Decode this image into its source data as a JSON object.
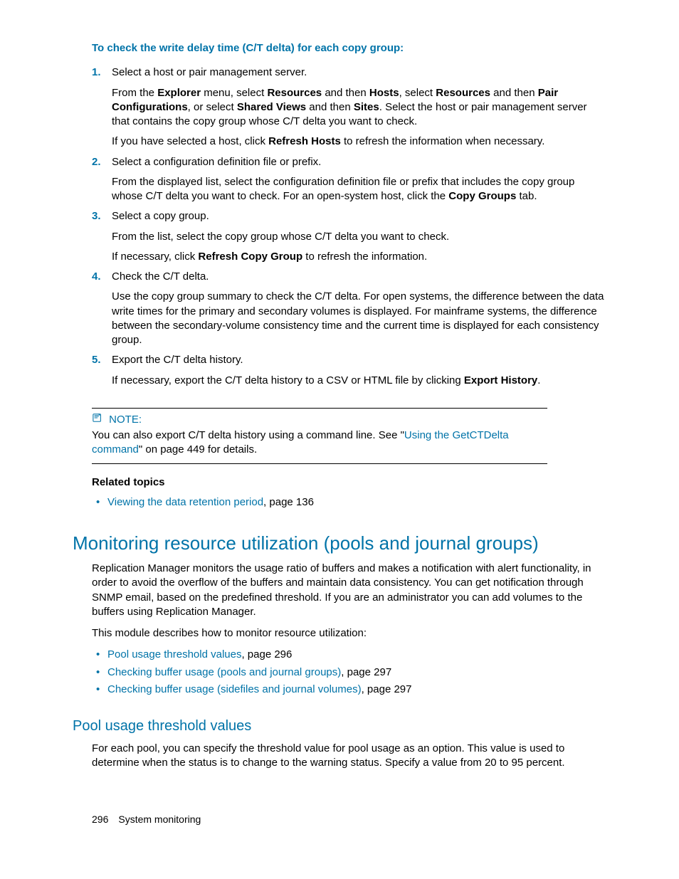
{
  "intro_heading": "To check the write delay time (C/T delta) for each copy group:",
  "steps": [
    {
      "num": "1.",
      "lead": "Select a host or pair management server.",
      "paras": [
        {
          "parts": [
            {
              "t": "From the "
            },
            {
              "b": "Explorer"
            },
            {
              "t": " menu, select "
            },
            {
              "b": "Resources"
            },
            {
              "t": " and then "
            },
            {
              "b": "Hosts"
            },
            {
              "t": ", select "
            },
            {
              "b": "Resources"
            },
            {
              "t": " and then "
            },
            {
              "b": "Pair Configurations"
            },
            {
              "t": ", or select "
            },
            {
              "b": "Shared Views"
            },
            {
              "t": " and then "
            },
            {
              "b": "Sites"
            },
            {
              "t": ". Select the host or pair management server that contains the copy group whose C/T delta you want to check."
            }
          ]
        },
        {
          "parts": [
            {
              "t": "If you have selected a host, click "
            },
            {
              "b": "Refresh Hosts"
            },
            {
              "t": " to refresh the information when necessary."
            }
          ]
        }
      ]
    },
    {
      "num": "2.",
      "lead": "Select a configuration definition file or prefix.",
      "paras": [
        {
          "parts": [
            {
              "t": "From the displayed list, select the configuration definition file or prefix that includes the copy group whose C/T delta you want to check. For an open-system host, click the "
            },
            {
              "b": "Copy Groups"
            },
            {
              "t": " tab."
            }
          ]
        }
      ]
    },
    {
      "num": "3.",
      "lead": "Select a copy group.",
      "paras": [
        {
          "parts": [
            {
              "t": "From the list, select the copy group whose C/T delta you want to check."
            }
          ]
        },
        {
          "parts": [
            {
              "t": "If necessary, click "
            },
            {
              "b": "Refresh Copy Group"
            },
            {
              "t": " to refresh the information."
            }
          ]
        }
      ]
    },
    {
      "num": "4.",
      "lead": "Check the C/T delta.",
      "paras": [
        {
          "parts": [
            {
              "t": "Use the copy group summary to check the C/T delta. For open systems, the difference between the data write times for the primary and secondary volumes is displayed. For mainframe systems, the difference between the secondary-volume consistency time and the current time is displayed for each consistency group."
            }
          ]
        }
      ]
    },
    {
      "num": "5.",
      "lead": "Export the C/T delta history.",
      "paras": [
        {
          "parts": [
            {
              "t": "If necessary, export the C/T delta history to a CSV or HTML file by clicking "
            },
            {
              "b": "Export History"
            },
            {
              "t": "."
            }
          ]
        }
      ]
    }
  ],
  "note": {
    "label": "NOTE:",
    "pre": "You can also export C/T delta history using a command line. See \"",
    "link": "Using the GetCTDelta command",
    "post": "\" on page 449 for details."
  },
  "related_heading": "Related topics",
  "related": [
    {
      "link": "Viewing the data retention period",
      "suffix": ", page 136"
    }
  ],
  "h2": "Monitoring resource utilization (pools and journal groups)",
  "h2_body1": "Replication Manager monitors the usage ratio of buffers and makes a notification with alert functionality, in order to avoid the overflow of the buffers and maintain data consistency. You can get notification through SNMP email, based on the predefined threshold. If you are an administrator you can add volumes to the buffers using Replication Manager.",
  "h2_body2": "This module describes how to monitor resource utilization:",
  "toc": [
    {
      "link": "Pool usage threshold values",
      "suffix": ", page 296"
    },
    {
      "link": "Checking buffer usage (pools and journal groups)",
      "suffix": ", page 297"
    },
    {
      "link": "Checking buffer usage (sidefiles and journal volumes)",
      "suffix": ", page 297"
    }
  ],
  "h3": "Pool usage threshold values",
  "h3_body": "For each pool, you can specify the threshold value for pool usage as an option. This value is used to determine when the status is to change to the warning status. Specify a value from 20 to 95 percent.",
  "footer": {
    "page": "296",
    "chapter": "System monitoring"
  }
}
